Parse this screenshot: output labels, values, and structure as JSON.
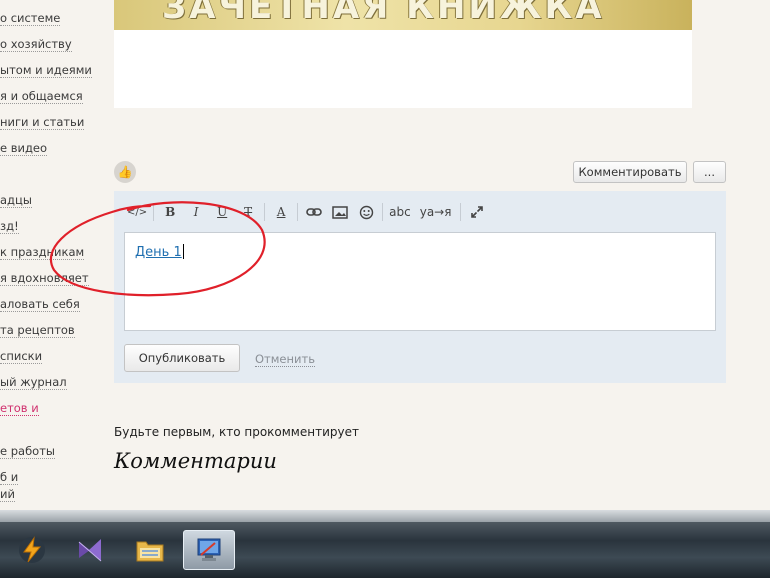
{
  "sidebar": {
    "items": [
      {
        "label": "о системе"
      },
      {
        "label": "о хозяйству"
      },
      {
        "label": "ытом и идеями"
      },
      {
        "label": "я и общаемся"
      },
      {
        "label": "ниги и статьи"
      },
      {
        "label": "е видео"
      },
      {
        "label": "адцы"
      },
      {
        "label": "зд!"
      },
      {
        "label": "к праздникам"
      },
      {
        "label": "я вдохновляет"
      },
      {
        "label": "аловать себя"
      },
      {
        "label": "та рецептов"
      },
      {
        "label": "списки"
      },
      {
        "label": "ый журнал"
      },
      {
        "label": "етов и"
      },
      {
        "label": "е работы"
      },
      {
        "label": "б и"
      },
      {
        "label": "ий"
      }
    ]
  },
  "banner": {
    "text": "ЗАЧЕТНАЯ КНИЖКА"
  },
  "actions": {
    "comment_button": "Комментировать",
    "more_button": "..."
  },
  "toolbar": {
    "code": "</>",
    "bold": "B",
    "italic": "I",
    "underline": "U",
    "strike": "T",
    "color": "A",
    "spellcheck": "abc",
    "translit": "уа→я"
  },
  "editor": {
    "content": "День 1"
  },
  "form": {
    "publish_button": "Опубликовать",
    "cancel_link": "Отменить"
  },
  "comments": {
    "empty_message": "Будьте первым, кто прокомментирует",
    "heading": "Комментарии"
  },
  "colors": {
    "annotation": "#e0202a",
    "link": "#1f6fb0",
    "panel": "#e4ebf2"
  },
  "taskbar": {
    "icons": [
      "lightning-app-icon",
      "visual-studio-icon",
      "file-explorer-icon",
      "remote-desktop-icon"
    ]
  }
}
